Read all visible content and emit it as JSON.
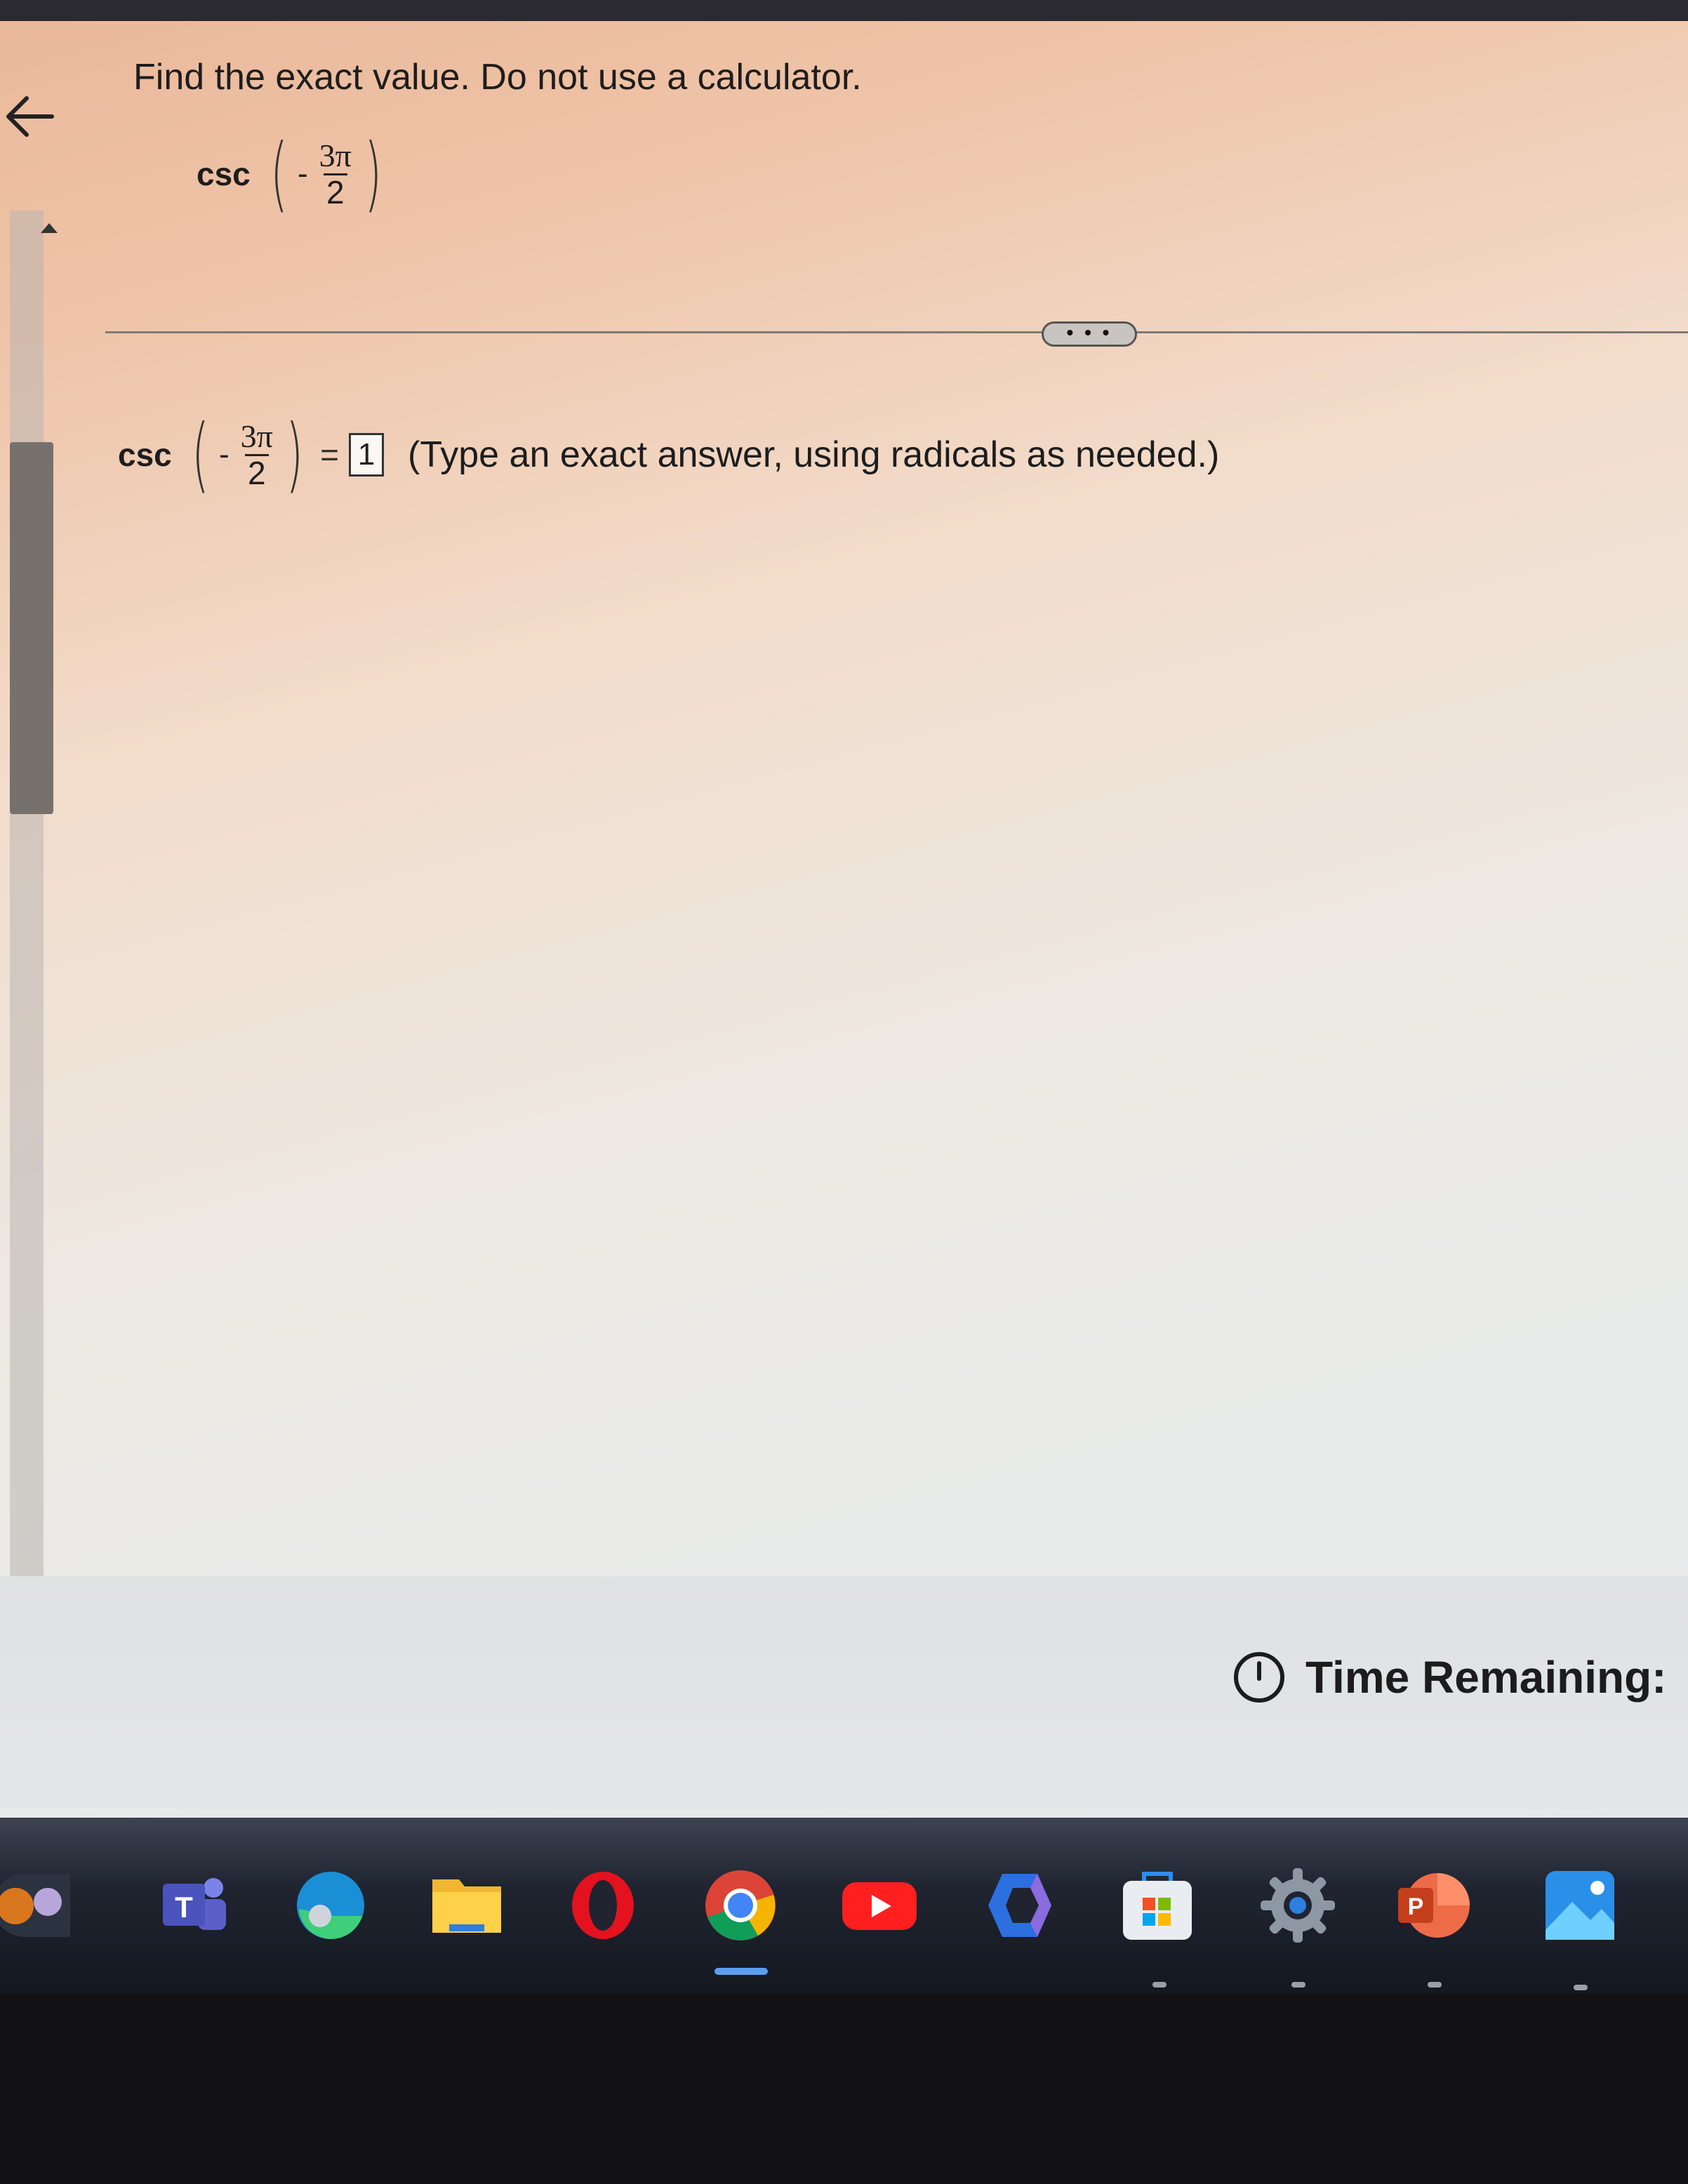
{
  "question": {
    "instruction": "Find the exact value. Do not use a calculator.",
    "expression": {
      "function": "csc",
      "sign": "-",
      "numerator": "3π",
      "denominator": "2"
    }
  },
  "divider": {
    "more_label": "• • •"
  },
  "answer": {
    "function": "csc",
    "sign": "-",
    "numerator": "3π",
    "denominator": "2",
    "equals": "=",
    "input_value": "1",
    "hint": "(Type an exact answer, using radicals as needed.)"
  },
  "footer": {
    "time_label": "Time Remaining:"
  },
  "taskbar": {
    "apps": [
      "widgets-icon",
      "teams-icon",
      "edge-icon",
      "file-explorer-icon",
      "opera-icon",
      "chrome-icon",
      "youtube-icon",
      "copilot-icon",
      "microsoft-store-icon",
      "settings-icon",
      "powerpoint-icon",
      "photos-icon"
    ],
    "active_app": "chrome-icon"
  },
  "colors": {
    "accent": "#5aa0f0",
    "text": "#1d1d1d",
    "background_top": "#eab89a",
    "background_bottom": "#e4e7e8"
  }
}
